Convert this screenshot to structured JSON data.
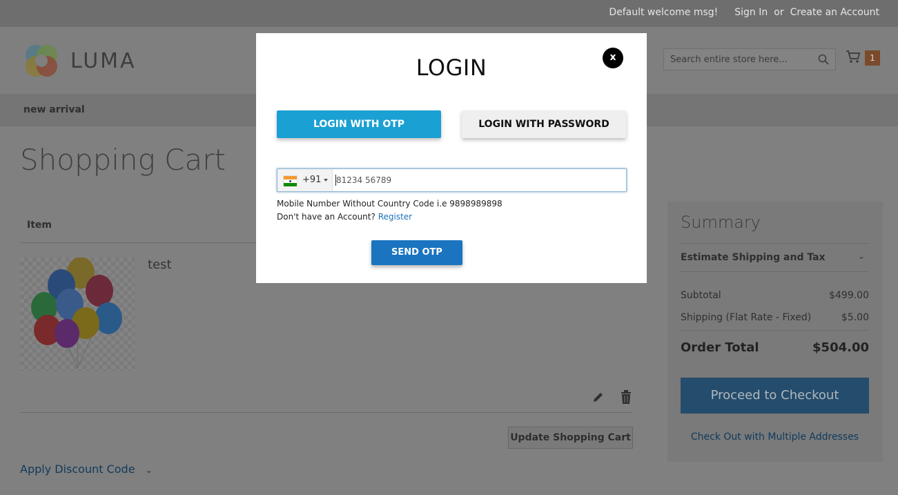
{
  "top_links": {
    "welcome": "Default welcome msg!",
    "sign_in": "Sign In",
    "or": "or",
    "create_account": "Create an Account"
  },
  "header": {
    "logo_text": "LUMA",
    "search_placeholder": "Search entire store here...",
    "cart_count": "1"
  },
  "nav": {
    "items": [
      "new arrival"
    ]
  },
  "cart": {
    "page_title": "Shopping Cart",
    "column_item": "Item",
    "product_name": "test",
    "update_button": "Update Shopping Cart",
    "discount_label": "Apply Discount Code"
  },
  "summary": {
    "title": "Summary",
    "estimate_label": "Estimate Shipping and Tax",
    "subtotal_label": "Subtotal",
    "subtotal_value": "$499.00",
    "shipping_label": "Shipping (Flat Rate - Fixed)",
    "shipping_value": "$5.00",
    "total_label": "Order Total",
    "total_value": "$504.00",
    "checkout_button": "Proceed to Checkout",
    "multi_address_link": "Check Out with Multiple Addresses"
  },
  "login_modal": {
    "title": "LOGIN",
    "close_label": "x",
    "tab_otp": "LOGIN WITH OTP",
    "tab_password": "LOGIN WITH PASSWORD",
    "country_code": "+91",
    "phone_placeholder": "81234 56789",
    "hint": "Mobile Number Without Country Code i.e 9898989898",
    "no_account_text": "Don't have an Account?",
    "register_link": "Register",
    "send_otp_button": "SEND OTP"
  },
  "colors": {
    "otp_tab": "#1aa0d2",
    "send_otp": "#1a74c0",
    "overlay_dim": "#808080",
    "cart_badge": "#ff5501"
  }
}
